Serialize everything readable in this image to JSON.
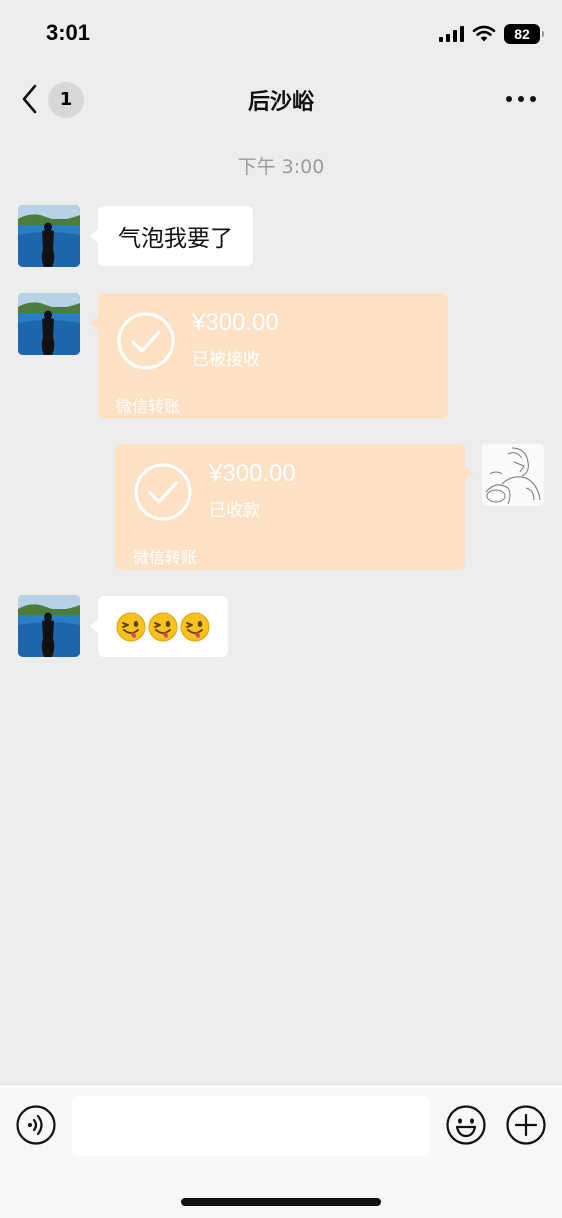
{
  "status_bar": {
    "time": "3:01",
    "battery": "82",
    "icons": [
      "signal-icon",
      "wifi-icon",
      "battery-icon"
    ]
  },
  "nav": {
    "back_icon": "chevron-left-icon",
    "unread_count": "1",
    "title": "后沙峪",
    "more_icon": "more-dots-icon"
  },
  "chat": {
    "timestamp": "下午 3:00",
    "messages": [
      {
        "type": "text",
        "sender": "contact",
        "text": "气泡我要了"
      },
      {
        "type": "transfer",
        "sender": "contact",
        "amount": "¥300.00",
        "status": "已被接收",
        "label": "微信转账"
      },
      {
        "type": "transfer",
        "sender": "me",
        "amount": "¥300.00",
        "status": "已收款",
        "label": "微信转账"
      },
      {
        "type": "emoji",
        "sender": "contact",
        "emojis": [
          "winking-tongue-face",
          "winking-tongue-face",
          "winking-tongue-face"
        ]
      }
    ]
  },
  "input_bar": {
    "voice_icon": "voice-icon",
    "input_value": "",
    "emoji_icon": "smile-icon",
    "plus_icon": "plus-circle-icon"
  },
  "colors": {
    "background": "#ededed",
    "transfer_card": "#fde1c4",
    "bubble": "#ffffff",
    "input_bar": "#f7f7f7"
  }
}
